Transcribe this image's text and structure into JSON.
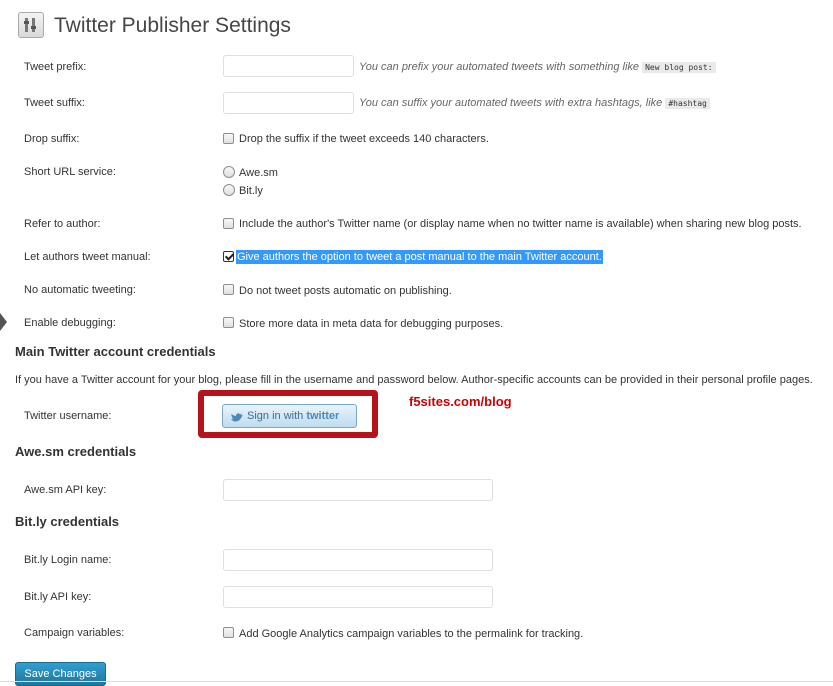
{
  "page": {
    "title": "Twitter Publisher Settings",
    "icon": "settings-icon"
  },
  "fields": {
    "tweet_prefix": {
      "label": "Tweet prefix:",
      "value": "",
      "hint": "You can prefix your automated tweets with something like",
      "hint_code": "New blog post:"
    },
    "tweet_suffix": {
      "label": "Tweet suffix:",
      "value": "",
      "hint": "You can suffix your automated tweets with extra hashtags, like",
      "hint_code": "#hashtag"
    },
    "drop_suffix": {
      "label": "Drop suffix:",
      "checked": false,
      "text": "Drop the suffix if the tweet exceeds 140 characters."
    },
    "short_url": {
      "label": "Short URL service:",
      "options": [
        "Awe.sm",
        "Bit.ly"
      ],
      "selected": null
    },
    "refer_author": {
      "label": "Refer to author:",
      "checked": false,
      "text": "Include the author's Twitter name (or display name when no twitter name is available) when sharing new blog posts."
    },
    "let_authors": {
      "label": "Let authors tweet manual:",
      "checked": true,
      "text": "Give authors the option to tweet a post manual to the main Twitter account."
    },
    "no_auto": {
      "label": "No automatic tweeting:",
      "checked": false,
      "text": "Do not tweet posts automatic on publishing."
    },
    "debugging": {
      "label": "Enable debugging:",
      "checked": false,
      "text": "Store more data in meta data for debugging purposes."
    }
  },
  "main_twitter": {
    "heading": "Main Twitter account credentials",
    "description": "If you have a Twitter account for your blog, please fill in the username and password below. Author-specific accounts can be provided in their personal profile pages.",
    "username_label": "Twitter username:",
    "signin_prefix": "Sign in with",
    "signin_brand": "twitter",
    "watermark": "f5sites.com/blog"
  },
  "awesm": {
    "heading": "Awe.sm credentials",
    "api_key_label": "Awe.sm API key:",
    "api_key_value": ""
  },
  "bitly": {
    "heading": "Bit.ly credentials",
    "login_label": "Bit.ly Login name:",
    "login_value": "",
    "api_key_label": "Bit.ly API key:",
    "api_key_value": "",
    "campaign_label": "Campaign variables:",
    "campaign_checked": false,
    "campaign_text": "Add Google Analytics campaign variables to the permalink for tracking."
  },
  "actions": {
    "save_label": "Save Changes"
  },
  "colors": {
    "primary_button": "#21759b",
    "selection_highlight": "#3399ff",
    "annotation_red": "#b5121b"
  }
}
